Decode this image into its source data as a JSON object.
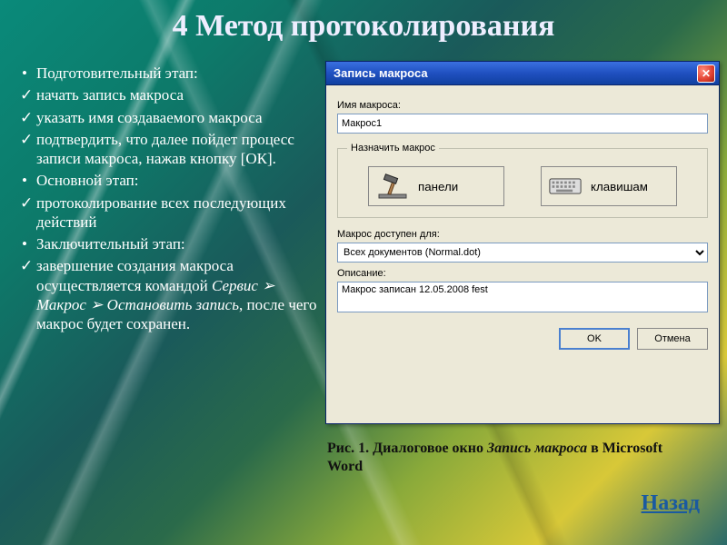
{
  "title": "4 Метод протоколирования",
  "bullets": [
    {
      "style": "bullet",
      "text": "Подготовительный этап:"
    },
    {
      "style": "check",
      "text": " начать запись макроса"
    },
    {
      "style": "check",
      "text": " указать имя создаваемого макроса"
    },
    {
      "style": "check",
      "text": " подтвердить, что далее пойдет процесс записи макроса, нажав кнопку [ОК]."
    },
    {
      "style": "bullet",
      "text": "Основной этап:"
    },
    {
      "style": "check",
      "text": " протоколирование всех последующих действий"
    },
    {
      "style": "bullet",
      "text": "Заключительный этап:"
    }
  ],
  "final_line_prefix": " завершение создания макроса осуществляется командой ",
  "final_cmd_1": "Сервис",
  "final_sep": " ➢ ",
  "final_cmd_2": "Макрос",
  "final_cmd_3": "Остановить запись",
  "final_line_suffix": ", после чего макрос будет сохранен.",
  "dialog": {
    "title": "Запись макроса",
    "name_label": "Имя макроса:",
    "name_value": "Макрос1",
    "assign_legend": "Назначить макрос",
    "panels_label": "панели",
    "keys_label": "клавишам",
    "available_label": "Макрос доступен для:",
    "available_value": "Всех документов (Normal.dot)",
    "desc_label": "Описание:",
    "desc_value": "Макрос записан 12.05.2008 fest",
    "ok": "OK",
    "cancel": "Отмена"
  },
  "caption_prefix": "Рис. 1. Диалоговое окно ",
  "caption_italic": "Запись макроса",
  "caption_suffix": " в Microsoft Word",
  "back": "Назад"
}
